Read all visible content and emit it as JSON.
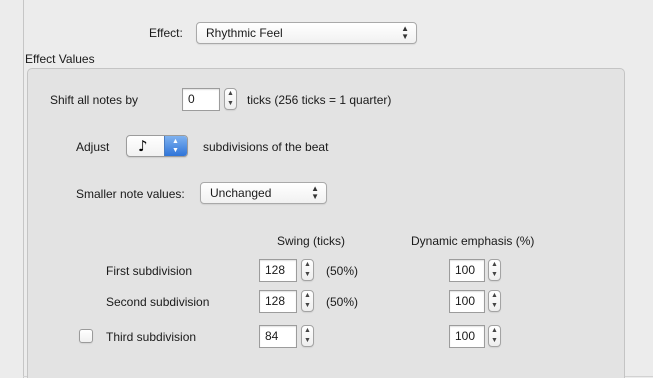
{
  "effect": {
    "label": "Effect:",
    "selected": "Rhythmic Feel"
  },
  "group_title": "Effect Values",
  "shift": {
    "label_before": "Shift all notes by",
    "value": "0",
    "label_after": "ticks (256 ticks = 1 quarter)"
  },
  "adjust": {
    "label_before": "Adjust",
    "note_glyph": "♪",
    "label_after": "subdivisions of the beat"
  },
  "smaller": {
    "label": "Smaller note values:",
    "selected": "Unchanged"
  },
  "columns": {
    "swing": "Swing (ticks)",
    "dynamic": "Dynamic emphasis (%)"
  },
  "rows": [
    {
      "label": "First subdivision",
      "swing": "128",
      "percent": "(50%)",
      "dynamic": "100"
    },
    {
      "label": "Second subdivision",
      "swing": "128",
      "percent": "(50%)",
      "dynamic": "100"
    },
    {
      "label": "Third subdivision",
      "swing": "84",
      "dynamic": "100",
      "checked": false
    }
  ],
  "glyphs": {
    "popup_arrows_up": "▲",
    "popup_arrows_down": "▼",
    "stepper_up": "▲",
    "stepper_down": "▼"
  },
  "colors": {
    "window_bg": "#ececec",
    "group_bg": "#e3e3e3",
    "accent_blue": "#2f74d8"
  }
}
